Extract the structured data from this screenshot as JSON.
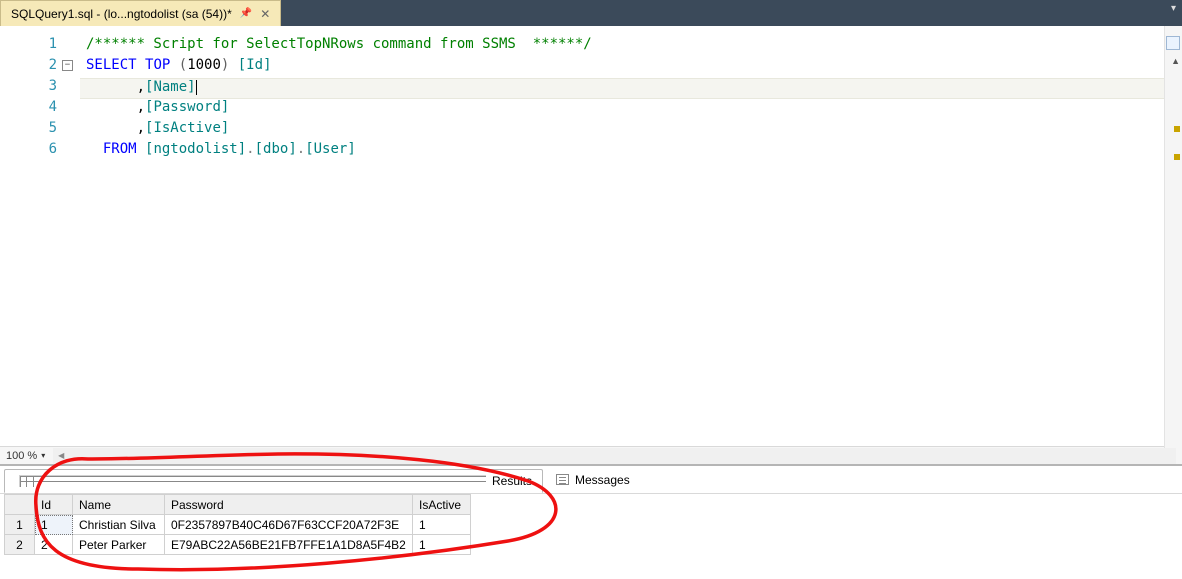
{
  "tab": {
    "title": "SQLQuery1.sql - (lo...ngtodolist (sa (54))*",
    "pin_glyph": "📌",
    "close_glyph": "✕",
    "dropdown_glyph": "▾"
  },
  "editor": {
    "lines": [
      {
        "n": "1",
        "kind": "comment",
        "text": "/****** Script for SelectTopNRows command from SSMS  ******/"
      },
      {
        "n": "2",
        "kind": "select",
        "kw1": "SELECT",
        "kw2": "TOP",
        "paren_open": "(",
        "num": "1000",
        "paren_close": ")",
        "ident": "[Id]"
      },
      {
        "n": "3",
        "kind": "col",
        "prefix": "      ,",
        "ident": "[Name]",
        "current": true
      },
      {
        "n": "4",
        "kind": "col",
        "prefix": "      ,",
        "ident": "[Password]"
      },
      {
        "n": "5",
        "kind": "col",
        "prefix": "      ,",
        "ident": "[IsActive]"
      },
      {
        "n": "6",
        "kind": "from",
        "kw": "FROM",
        "p1": "[ngtodolist]",
        "dot1": ".",
        "p2": "[dbo]",
        "dot2": ".",
        "p3": "[User]"
      }
    ],
    "fold_glyph": "−"
  },
  "zoom": {
    "label": "100 %",
    "caret": "▾",
    "left_arrow": "◀"
  },
  "results": {
    "tabs": {
      "results": "Results",
      "messages": "Messages"
    },
    "columns": [
      "Id",
      "Name",
      "Password",
      "IsActive"
    ],
    "rows": [
      {
        "n": "1",
        "Id": "1",
        "Name": "Christian Silva",
        "Password": "0F2357897B40C46D67F63CCF20A72F3E",
        "IsActive": "1"
      },
      {
        "n": "2",
        "Id": "2",
        "Name": "Peter Parker",
        "Password": "E79ABC22A56BE21FB7FFE1A1D8A5F4B2",
        "IsActive": "1"
      }
    ]
  },
  "icons": {
    "split": "",
    "scroll_up": "▲"
  }
}
